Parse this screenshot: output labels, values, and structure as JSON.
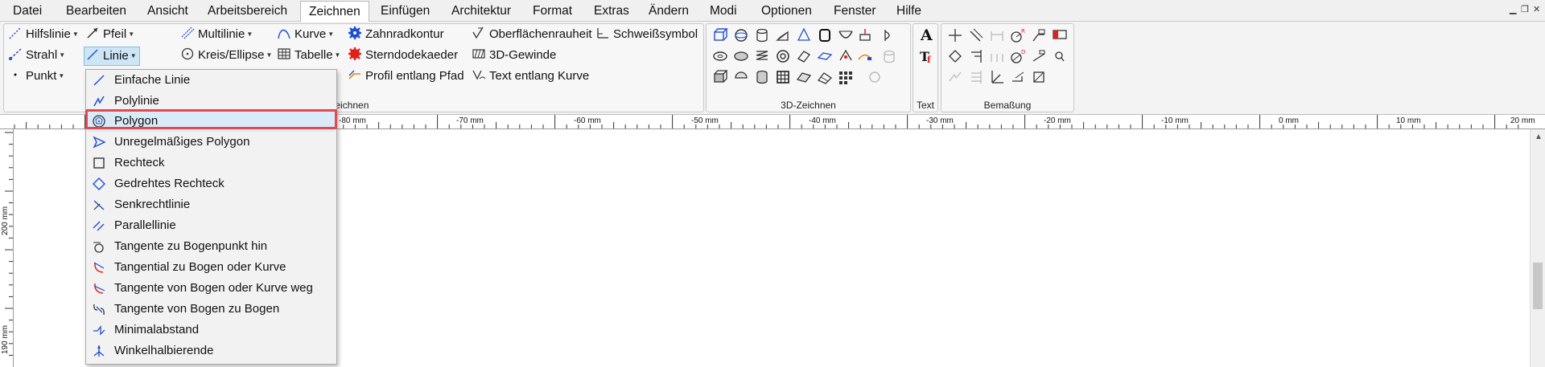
{
  "menubar": {
    "items": [
      "Datei",
      "Bearbeiten",
      "Ansicht",
      "Arbeitsbereich",
      "Zeichnen",
      "Einfügen",
      "Architektur",
      "Format",
      "Extras",
      "Ändern",
      "Modi",
      "Optionen",
      "Fenster",
      "Hilfe"
    ],
    "active": "Zeichnen"
  },
  "ribbon": {
    "col1": [
      "Hilfslinie",
      "Strahl",
      "Punkt"
    ],
    "col2": [
      "Pfeil",
      "Linie"
    ],
    "col3": [
      "Multilinie",
      "Kreis/Ellipse"
    ],
    "col4": [
      "Kurve",
      "Tabelle"
    ],
    "col5": [
      "Zahnradkontur",
      "Sterndodekaeder",
      "Profil entlang Pfad"
    ],
    "col6": [
      "Oberflächenrauheit",
      "3D-Gewinde",
      "Text entlang Kurve"
    ],
    "col7": [
      "Schweißsymbol"
    ],
    "groups": {
      "g2d": "-Zeichnen",
      "g3d": "3D-Zeichnen",
      "gtext": "Text",
      "gdim": "Bemaßung"
    }
  },
  "ruler": {
    "h_labels": [
      "-80 mm",
      "-70 mm",
      "-60 mm",
      "-50 mm",
      "-40 mm",
      "-30 mm",
      "-20 mm",
      "-10 mm",
      "0 mm",
      "10 mm",
      "20 mm"
    ],
    "v_labels": [
      "200 mm",
      "190 mm"
    ]
  },
  "dropdown": {
    "items": [
      "Einfache Linie",
      "Polylinie",
      "Polygon",
      "Unregelmäßiges Polygon",
      "Rechteck",
      "Gedrehtes Rechteck",
      "Senkrechtlinie",
      "Parallellinie",
      "Tangente zu Bogenpunkt hin",
      "Tangential zu Bogen oder Kurve",
      "Tangente von Bogen oder Kurve weg",
      "Tangente von Bogen zu Bogen",
      "Minimalabstand",
      "Winkelhalbierende"
    ],
    "highlighted": "Polygon"
  },
  "colors": {
    "accent_blue": "#1f4fd1",
    "highlight_red": "#e5484d",
    "selected_bg": "#cde6f7"
  }
}
